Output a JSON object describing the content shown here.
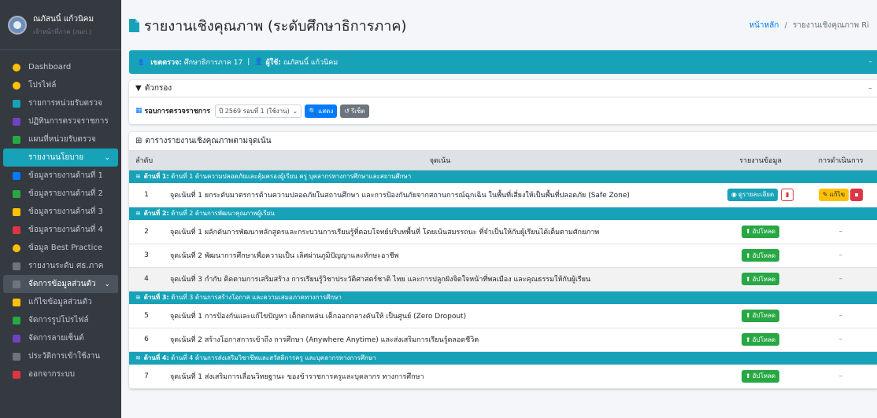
{
  "user": {
    "name": "ณภัสนนิ์ แก้วนิคม",
    "role": "เจ้าหน้าที่ภาค (ภมก.)"
  },
  "sidebar": {
    "items": [
      {
        "label": "Dashboard",
        "icon": "dashboard-icon",
        "color": "#ffc107"
      },
      {
        "label": "โปรไฟล์",
        "icon": "user-icon",
        "color": "#ffc107"
      },
      {
        "label": "รายการหน่วยรับตรวจ",
        "icon": "list-icon",
        "color": "#17a2b8"
      },
      {
        "label": "ปฏิทินการตรวจราชการ",
        "icon": "calendar-icon",
        "color": "#6f42c1"
      },
      {
        "label": "แผนที่หน่วยรับตรวจ",
        "icon": "map-icon",
        "color": "#28a745"
      },
      {
        "label": "รายงานนโยบาย",
        "icon": "report-icon",
        "color": "#17a2b8"
      },
      {
        "label": "ข้อมูลรายงานด้านที่ 1",
        "icon": "file-icon",
        "color": "#007bff"
      },
      {
        "label": "ข้อมูลรายงานด้านที่ 2",
        "icon": "file-icon",
        "color": "#28a745"
      },
      {
        "label": "ข้อมูลรายงานด้านที่ 3",
        "icon": "file-icon",
        "color": "#ffc107"
      },
      {
        "label": "ข้อมูลรายงานด้านที่ 4",
        "icon": "file-icon",
        "color": "#dc3545"
      },
      {
        "label": "ข้อมูล Best Practice",
        "icon": "award-icon",
        "color": "#ffc107"
      },
      {
        "label": "รายงานระดับ ศธ.ภาค",
        "icon": "chart-icon",
        "color": "#6c757d"
      },
      {
        "label": "จัดการข้อมูลส่วนตัว",
        "icon": "settings-icon",
        "color": "#6c757d"
      },
      {
        "label": "แก้ไขข้อมูลส่วนตัว",
        "icon": "user-edit-icon",
        "color": "#ffc107"
      },
      {
        "label": "จัดการรูปโปรไฟล์",
        "icon": "image-icon",
        "color": "#28a745"
      },
      {
        "label": "จัดการลายเซ็นต์",
        "icon": "signature-icon",
        "color": "#6f42c1"
      },
      {
        "label": "ประวัติการเข้าใช้งาน",
        "icon": "history-icon",
        "color": "#6c757d"
      },
      {
        "label": "ออกจากระบบ",
        "icon": "logout-icon",
        "color": "#dc3545"
      }
    ]
  },
  "header": {
    "title": "รายงานเชิงคุณภาพ (ระดับศึกษาธิการภาค)",
    "breadcrumb_home": "หน้าหลัก",
    "breadcrumb_sep": "/",
    "breadcrumb_current": "รายงานเชิงคุณภาพ Ri"
  },
  "info_bar": {
    "zone_label": "เขตตรวจ:",
    "zone_value": "ศึกษาธิการภาค 17",
    "sep": "|",
    "user_label": "ผู้ใช้:",
    "user_value": "ณภัสนนิ์ แก้วนิคม"
  },
  "filter": {
    "title": "ตัวกรอง",
    "round_label": "รอบการตรวจราชการ",
    "round_value": "ปี 2569 รอบที่ 1 (ใช้งาน)",
    "show_label": "แสดง",
    "reset_label": "รีเซ็ต"
  },
  "table": {
    "title": "ตารางรายงานเชิงคุณภาพตามจุดเน้น",
    "columns": [
      "ลำดับ",
      "จุดเน้น",
      "รายงานข้อมูล",
      "การดำเนินการ"
    ],
    "view_label": "ดูรายละเอียด",
    "upload_label": "อัปโหลด",
    "edit_label": "แก้ไข",
    "dash": "–",
    "groups": [
      {
        "title_bold": "ด้านที่ 1:",
        "title": "ด้านที่ 1 ด้านความปลอดภัยและคุ้มครองผู้เรียน ครู บุคลากรทางการศึกษาและสถานศึกษา",
        "rows": [
          {
            "no": "1",
            "text": "จุดเน้นที่ 1 ยกระดับมาตรการด้านความปลอดภัยในสถานศึกษา และการป้องกันภัยจากสถานการณ์ฉุกเฉิน ในพื้นที่เสี่ยงให้เป็นพื้นที่ปลอดภัย (Safe Zone)",
            "submitted": true
          }
        ]
      },
      {
        "title_bold": "ด้านที่ 2:",
        "title": "ด้านที่ 2 ด้านการพัฒนาคุณภาพผู้เรียน",
        "rows": [
          {
            "no": "2",
            "text": "จุดเน้นที่ 1 ผลักดันการพัฒนาหลักสูตรและกระบวนการเรียนรู้ที่ตอบโจทย์บริบทพื้นที่ โดยเน้นสมรรถนะ ที่จำเป็นให้กับผู้เรียนได้เต็มตามศักยภาพ",
            "submitted": false
          },
          {
            "no": "3",
            "text": "จุดเน้นที่ 2 พัฒนาการศึกษาเพื่อความเป็น เลิศผ่านภูมิปัญญาและทักษะอาชีพ",
            "submitted": false
          },
          {
            "no": "4",
            "text": "จุดเน้นที่ 3 กำกับ ติดตามการเสริมสร้าง การเรียนรู้วิชาประวัติศาสตร์ชาติ ไทย และการปลูกฝังจิตใจหน้าที่พลเมือง และคุณธรรมให้กับผู้เรียน",
            "submitted": false
          }
        ]
      },
      {
        "title_bold": "ด้านที่ 3:",
        "title": "ด้านที่ 3 ด้านการสร้างโอกาส และความเสมอภาคทางการศึกษา",
        "rows": [
          {
            "no": "5",
            "text": "จุดเน้นที่ 1 การป้องกันและแก้ไขปัญหา เด็กตกหล่น เด็กออกกลางคันให้ เป็นศูนย์ (Zero Dropout)",
            "submitted": false
          },
          {
            "no": "6",
            "text": "จุดเน้นที่ 2 สร้างโอกาสการเข้าถึง การศึกษา (Anywhere Anytime) และส่งเสริมการเรียนรู้ตลอดชีวิต",
            "submitted": false
          }
        ]
      },
      {
        "title_bold": "ด้านที่ 4:",
        "title": "ด้านที่ 4 ด้านการส่งเสริมวิชาชีพและสวัสดิการครู และบุคลากรทางการศึกษา",
        "rows": [
          {
            "no": "7",
            "text": "จุดเน้นที่ 1 ส่งเสริมการเลื่อนวิทยฐานะ ของข้าราชการครูและบุคลากร ทางการศึกษา",
            "submitted": false
          }
        ]
      }
    ]
  },
  "colors": {
    "accent": "#17a2b8",
    "sidebar": "#343a40",
    "upload": "#28a745",
    "edit": "#ffc107",
    "danger": "#dc3545"
  }
}
